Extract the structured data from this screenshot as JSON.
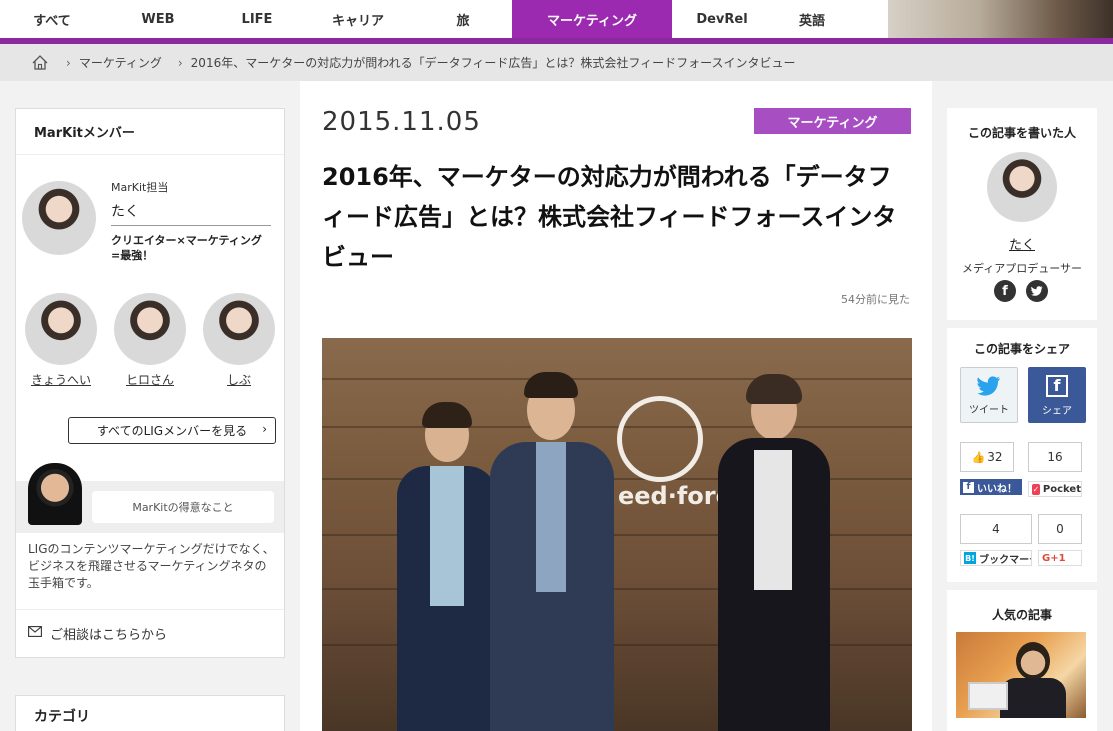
{
  "nav": {
    "tabs": [
      {
        "label": "すべて"
      },
      {
        "label": "WEB"
      },
      {
        "label": "LIFE"
      },
      {
        "label": "キャリア"
      },
      {
        "label": "旅"
      },
      {
        "label": "マーケティング"
      },
      {
        "label": "DevRel"
      },
      {
        "label": "英語"
      }
    ],
    "active_index": 5,
    "accent_color": "#9b2ab0"
  },
  "breadcrumb": {
    "home_icon": "home-icon",
    "items": [
      "マーケティング",
      "2016年、マーケターの対応力が問われる「データフィード広告」とは？株式会社フィードフォースインタビュー"
    ]
  },
  "left": {
    "member_title": "MarKitメンバー",
    "lead": {
      "role": "MarKit担当",
      "name": "たく",
      "desc": "クリエイター×マーケティング=最強！"
    },
    "members": [
      {
        "name": "きょうへい"
      },
      {
        "name": "ヒロさん"
      },
      {
        "name": "しぶ"
      }
    ],
    "all_members_button": "すべてのLIGメンバーを見る",
    "good_at": "MarKitの得意なこと",
    "good_desc": "LIGのコンテンツマーケティングだけでなく、ビジネスを飛躍させるマーケティングネタの玉手箱です。",
    "consult": "ご相談はこちらから",
    "category_title": "カテゴリ"
  },
  "article": {
    "date": "2015.11.05",
    "category": "マーケティング",
    "title": "2016年、マーケターの対応力が問われる「データフィード広告」とは？株式会社フィードフォースインタビュー",
    "viewed": "54分前に見た",
    "hero_logo_text": "eed·force"
  },
  "right": {
    "author_title": "この記事を書いた人",
    "author_name": "たく",
    "author_role": "メディアプロデューサー",
    "share_title": "この記事をシェア",
    "tweet_label": "ツイート",
    "share_label": "シェア",
    "like_count": "32",
    "pocket_count": "16",
    "like_label": "いいね！",
    "pocket_label": "Pocket",
    "hatena_count": "4",
    "gplus_count": "0",
    "hatena_label": "ブックマーク",
    "gplus_label": "G+1",
    "popular_title": "人気の記事"
  }
}
